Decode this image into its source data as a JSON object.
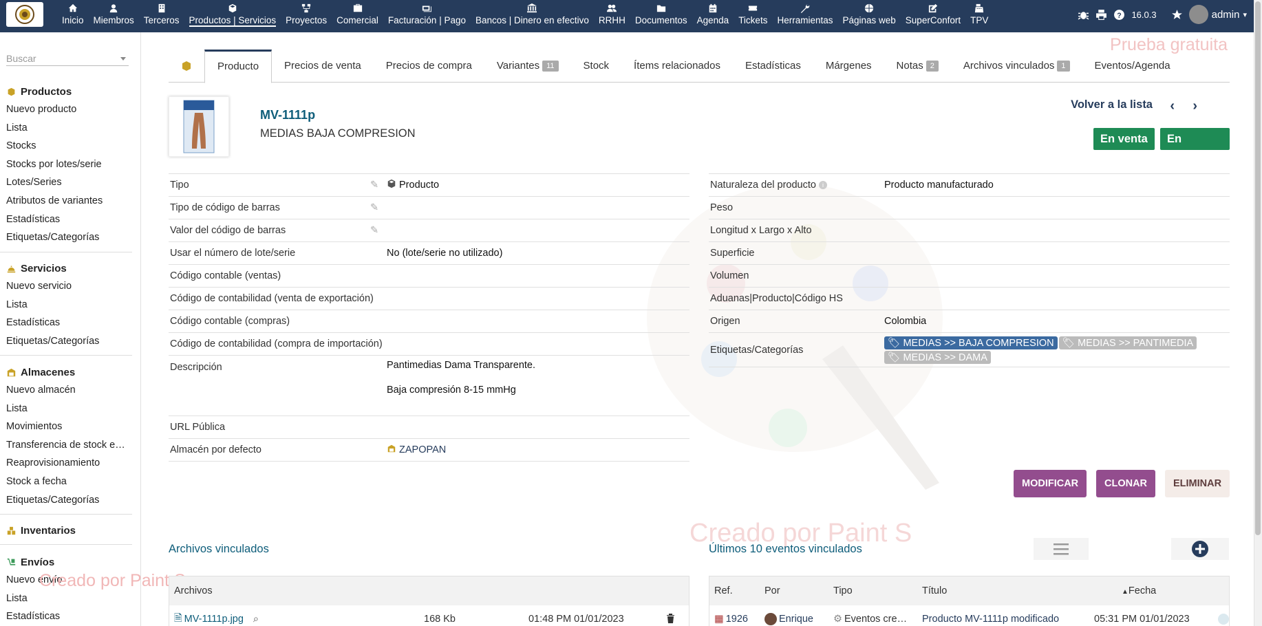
{
  "topbar": {
    "nav": [
      {
        "label": "Inicio",
        "icon": "home-icon"
      },
      {
        "label": "Miembros",
        "icon": "user-icon"
      },
      {
        "label": "Terceros",
        "icon": "building-icon"
      },
      {
        "label": "Productos | Servicios",
        "icon": "cube-icon"
      },
      {
        "label": "Proyectos",
        "icon": "sitemap-icon"
      },
      {
        "label": "Comercial",
        "icon": "briefcase-icon"
      },
      {
        "label": "Facturación | Pago",
        "icon": "money-icon"
      },
      {
        "label": "Bancos | Dinero en efectivo",
        "icon": "bank-icon"
      },
      {
        "label": "RRHH",
        "icon": "users-icon"
      },
      {
        "label": "Documentos",
        "icon": "folder-icon"
      },
      {
        "label": "Agenda",
        "icon": "calendar-icon"
      },
      {
        "label": "Tickets",
        "icon": "ticket-icon"
      },
      {
        "label": "Herramientas",
        "icon": "wrench-icon"
      },
      {
        "label": "Páginas web",
        "icon": "globe-icon"
      },
      {
        "label": "SuperConfort",
        "icon": "edit-icon"
      },
      {
        "label": "TPV",
        "icon": "cash-register-icon"
      }
    ],
    "version": "16.0.3",
    "user": "admin"
  },
  "trial_text": "Prueba gratuita",
  "watermark_text": "Creado por Paint S",
  "sidebar": {
    "search_placeholder": "Buscar",
    "sections": [
      {
        "title": "Productos",
        "items": [
          "Nuevo producto",
          "Lista",
          "Stocks",
          "Stocks por lotes/serie",
          "Lotes/Series",
          "Atributos de variantes",
          "Estadísticas",
          "Etiquetas/Categorías"
        ]
      },
      {
        "title": "Servicios",
        "items": [
          "Nuevo servicio",
          "Lista",
          "Estadísticas",
          "Etiquetas/Categorías"
        ]
      },
      {
        "title": "Almacenes",
        "items": [
          "Nuevo almacén",
          "Lista",
          "Movimientos",
          "Transferencia de stock e…",
          "Reaprovisionamiento",
          "Stock a fecha",
          "Etiquetas/Categorías"
        ]
      },
      {
        "title": "Inventarios",
        "items": []
      },
      {
        "title": "Envíos",
        "items": [
          "Nuevo envío",
          "Lista",
          "Estadísticas"
        ]
      }
    ]
  },
  "tabs": [
    {
      "label": "Producto",
      "badge": null
    },
    {
      "label": "Precios de venta",
      "badge": null
    },
    {
      "label": "Precios de compra",
      "badge": null
    },
    {
      "label": "Variantes",
      "badge": "11"
    },
    {
      "label": "Stock",
      "badge": null
    },
    {
      "label": "Ítems relacionados",
      "badge": null
    },
    {
      "label": "Estadísticas",
      "badge": null
    },
    {
      "label": "Márgenes",
      "badge": null
    },
    {
      "label": "Notas",
      "badge": "2"
    },
    {
      "label": "Archivos vinculados",
      "badge": "1"
    },
    {
      "label": "Eventos/Agenda",
      "badge": null
    }
  ],
  "product": {
    "ref": "MV-1111p",
    "label": "MEDIAS BAJA COMPRESION",
    "back_to_list": "Volver a la lista",
    "status_sell": "En venta",
    "status_buy": "En compra"
  },
  "left_fields": [
    {
      "label": "Tipo",
      "value": "Producto"
    },
    {
      "label": "Tipo de código de barras",
      "value": ""
    },
    {
      "label": "Valor del código de barras",
      "value": ""
    },
    {
      "label": "Usar el número de lote/serie",
      "value": "No (lote/serie no utilizado)"
    },
    {
      "label": "Código contable (ventas)",
      "value": ""
    },
    {
      "label": "Código de contabilidad (venta de exportación)",
      "value": ""
    },
    {
      "label": "Código contable (compras)",
      "value": ""
    },
    {
      "label": "Código de contabilidad (compra de importación)",
      "value": ""
    }
  ],
  "description": {
    "label": "Descripción",
    "line1": "Pantimedias Dama Transparente.",
    "line2": "Baja compresión 8-15 mmHg"
  },
  "url_field": {
    "label": "URL Pública",
    "value": ""
  },
  "warehouse_field": {
    "label": "Almacén por defecto",
    "value": "ZAPOPAN"
  },
  "right_fields": [
    {
      "label": "Naturaleza del producto",
      "value": "Producto manufacturado"
    },
    {
      "label": "Peso",
      "value": ""
    },
    {
      "label": "Longitud x Largo x Alto",
      "value": ""
    },
    {
      "label": "Superficie",
      "value": ""
    },
    {
      "label": "Volumen",
      "value": ""
    },
    {
      "label": "Aduanas|Producto|Código HS",
      "value": ""
    },
    {
      "label": "Origen",
      "value": "Colombia"
    }
  ],
  "tags": {
    "label": "Etiquetas/Categorías",
    "items": [
      "MEDIAS >> BAJA COMPRESION",
      "MEDIAS >> PANTIMEDIA",
      "MEDIAS >> DAMA"
    ]
  },
  "colors": {
    "navbar": "#263c5c",
    "status_green": "#1e8b55",
    "action_purple": "#934d8e",
    "link_teal": "#0e5d7a",
    "tag_blue": "#3b6aa0"
  },
  "actions": {
    "modify": "MODIFICAR",
    "clone": "CLONAR",
    "delete": "ELIMINAR"
  },
  "files": {
    "title": "Archivos vinculados",
    "header": "Archivos",
    "rows": [
      {
        "name": "MV-1111p.jpg",
        "size": "168 Kb",
        "date": "01:48 PM 01/01/2023"
      }
    ]
  },
  "events": {
    "title": "Últimos 10 eventos vinculados",
    "headers": [
      "Ref.",
      "Por",
      "Tipo",
      "Título",
      "Fecha"
    ],
    "rows": [
      {
        "ref": "1926",
        "by": "Enrique",
        "type": "Eventos cre…",
        "title": "Producto MV-1111p modificado",
        "date": "05:31 PM 01/01/2023"
      }
    ]
  }
}
